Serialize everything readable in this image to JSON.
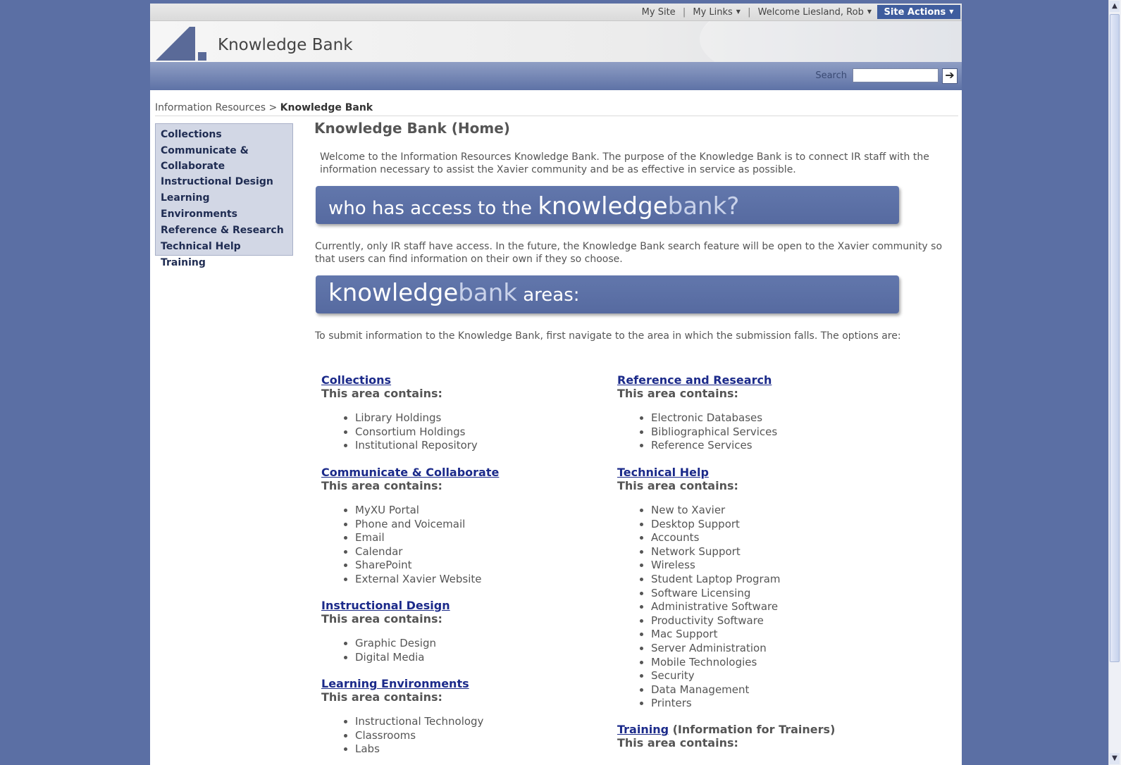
{
  "topbar": {
    "my_site": "My Site",
    "my_links": "My Links",
    "welcome": "Welcome Liesland, Rob",
    "site_actions": "Site Actions",
    "separator": "|"
  },
  "header": {
    "site_title": "Knowledge Bank",
    "search_label": "Search",
    "search_value": ""
  },
  "breadcrumb": {
    "parent": "Information Resources",
    "separator": ">",
    "current": "Knowledge Bank"
  },
  "sidebar": {
    "items": [
      {
        "label": "Collections"
      },
      {
        "label": "Communicate & Collaborate"
      },
      {
        "label": "Instructional Design"
      },
      {
        "label": "Learning Environments"
      },
      {
        "label": "Reference & Research"
      },
      {
        "label": "Technical Help"
      },
      {
        "label": "Training"
      }
    ]
  },
  "main": {
    "title": "Knowledge Bank (Home)",
    "intro": "Welcome to the Information Resources Knowledge Bank. The purpose of the Knowledge Bank is to connect IR staff with the information necessary to assist the Xavier community and be as effective in service as possible.",
    "banner1": {
      "part1": "who has access to the ",
      "part2": "knowledge",
      "part3": "bank?"
    },
    "access_text": "Currently, only IR staff have access. In the future, the Knowledge Bank search feature will be open to the Xavier community so that users can find information on their own if they so choose.",
    "banner2": {
      "part1": "knowledge",
      "part2": "bank",
      "part3": " areas:"
    },
    "submit_text": "To submit information to the Knowledge Bank, first navigate to the area in which the submission falls. The options are:",
    "contains_label": "This area contains:",
    "areas_left": [
      {
        "title": "Collections",
        "items": [
          "Library Holdings",
          "Consortium Holdings",
          "Institutional Repository"
        ]
      },
      {
        "title": "Communicate & Collaborate",
        "items": [
          "MyXU Portal",
          "Phone and Voicemail",
          "Email",
          "Calendar",
          "SharePoint",
          "External Xavier Website"
        ]
      },
      {
        "title": "Instructional Design",
        "items": [
          "Graphic Design",
          "Digital Media"
        ]
      },
      {
        "title": "Learning Environments",
        "items": [
          "Instructional Technology",
          "Classrooms",
          "Labs"
        ]
      }
    ],
    "areas_right": [
      {
        "title": "Reference and Research",
        "items": [
          "Electronic Databases",
          "Bibliographical Services",
          "Reference Services"
        ]
      },
      {
        "title": "Technical Help",
        "items": [
          "New to Xavier",
          "Desktop Support",
          "Accounts",
          "Network Support",
          "Wireless",
          "Student Laptop Program",
          "Software Licensing",
          "Administrative Software",
          "Productivity Software",
          "Mac Support",
          "Server Administration",
          "Mobile Technologies",
          "Security",
          "Data Management",
          "Printers"
        ]
      },
      {
        "title": "Training",
        "note": " (Information for Trainers)",
        "items": []
      }
    ]
  }
}
